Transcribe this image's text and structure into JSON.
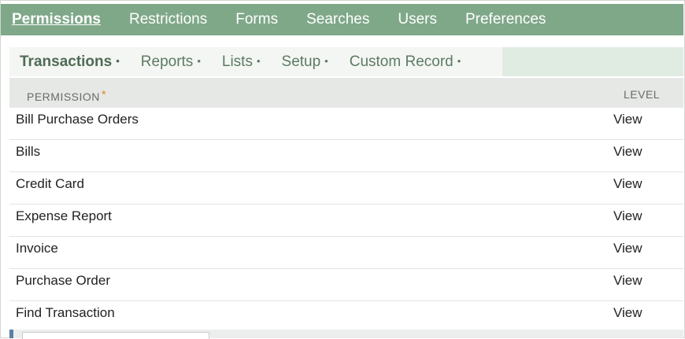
{
  "main_tabs": [
    {
      "label": "Permissions",
      "active": true
    },
    {
      "label": "Restrictions",
      "active": false
    },
    {
      "label": "Forms",
      "active": false
    },
    {
      "label": "Searches",
      "active": false
    },
    {
      "label": "Users",
      "active": false
    },
    {
      "label": "Preferences",
      "active": false
    }
  ],
  "sub_tabs": [
    {
      "label": "Transactions",
      "active": true
    },
    {
      "label": "Reports",
      "active": false
    },
    {
      "label": "Lists",
      "active": false
    },
    {
      "label": "Setup",
      "active": false
    },
    {
      "label": "Custom Record",
      "active": false
    }
  ],
  "sub_tab_dot": "•",
  "table": {
    "columns": {
      "permission": "PERMISSION",
      "required_marker": "*",
      "level": "LEVEL"
    },
    "rows": [
      {
        "permission": "Bill Purchase Orders",
        "level": "View"
      },
      {
        "permission": "Bills",
        "level": "View"
      },
      {
        "permission": "Credit Card",
        "level": "View"
      },
      {
        "permission": "Expense Report",
        "level": "View"
      },
      {
        "permission": "Invoice",
        "level": "View"
      },
      {
        "permission": "Purchase Order",
        "level": "View"
      },
      {
        "permission": "Find Transaction",
        "level": "View"
      }
    ]
  },
  "colors": {
    "main_tab_bar": "#7fa889",
    "sub_tab_text": "#5c7a63",
    "required_marker": "#e08a2e"
  }
}
